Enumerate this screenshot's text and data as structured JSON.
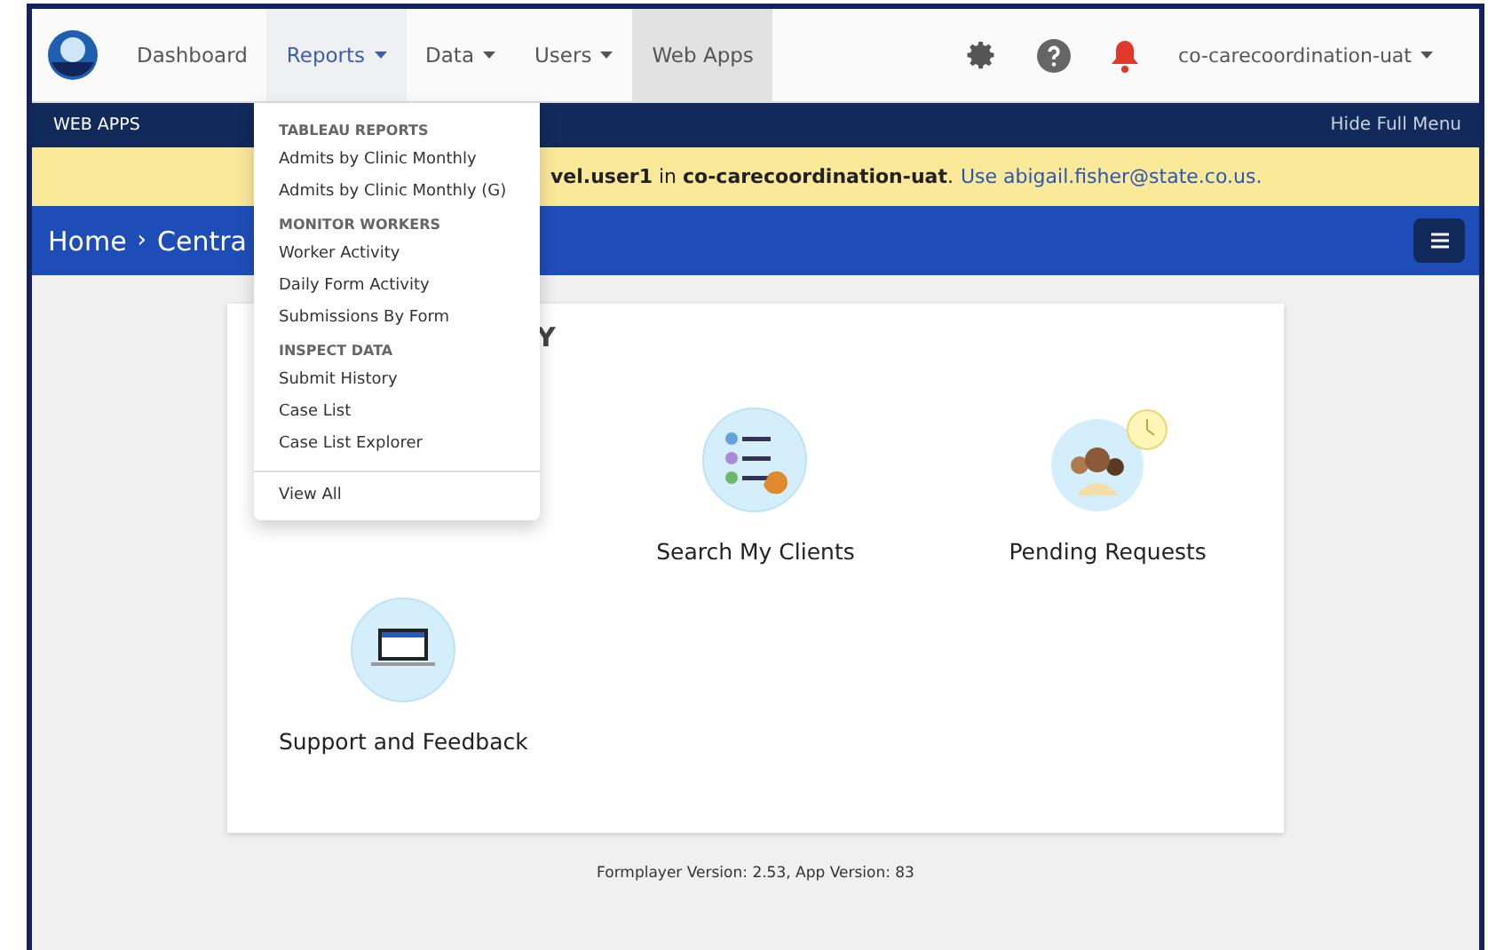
{
  "navbar": {
    "items": [
      {
        "label": "Dashboard",
        "dropdown": false,
        "selected": false
      },
      {
        "label": "Reports",
        "dropdown": true,
        "selected": true
      },
      {
        "label": "Data",
        "dropdown": true,
        "selected": false
      },
      {
        "label": "Users",
        "dropdown": true,
        "selected": false
      },
      {
        "label": "Web Apps",
        "dropdown": false,
        "selected": false,
        "current": true
      }
    ],
    "project": "co-carecoordination-uat"
  },
  "subbar": {
    "title": "WEB APPS",
    "toggle": "Hide Full Menu"
  },
  "banner": {
    "text": "**vel.user1** in **co-carecoordination-uat**.",
    "link": "Use abigail.fisher@state.co.us."
  },
  "breadcrumb": {
    "items": [
      "Home",
      "Centra"
    ],
    "separator": "›"
  },
  "dropdown": {
    "sections": [
      {
        "header": "TABLEAU REPORTS",
        "items": [
          "Admits by Clinic Monthly",
          "Admits by Clinic Monthly (G)"
        ]
      },
      {
        "header": "MONITOR WORKERS",
        "items": [
          "Worker Activity",
          "Daily Form Activity",
          "Submissions By Form"
        ]
      },
      {
        "header": "INSPECT DATA",
        "items": [
          "Submit History",
          "Case List",
          "Case List Explorer"
        ]
      }
    ],
    "footer": "View All"
  },
  "card": {
    "heading": "Y",
    "tiles": [
      {
        "kind": "covered"
      },
      {
        "kind": "search",
        "label": "Search My Clients"
      },
      {
        "kind": "pending",
        "label": "Pending Requests"
      },
      {
        "kind": "support",
        "label": "Support and Feedback"
      }
    ]
  },
  "footer": "Formplayer Version: 2.53, App Version: 83"
}
